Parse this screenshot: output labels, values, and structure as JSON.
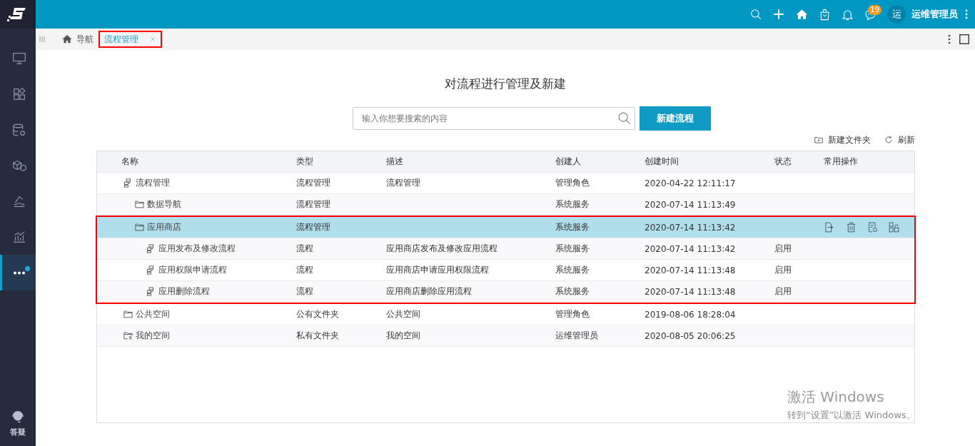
{
  "sidebar": {
    "items": [
      {
        "kind": "monitor",
        "selected": false,
        "notification": false
      },
      {
        "kind": "widgets",
        "selected": false,
        "notification": false
      },
      {
        "kind": "database",
        "selected": false,
        "notification": false
      },
      {
        "kind": "cubes",
        "selected": false,
        "notification": false
      },
      {
        "kind": "drafting",
        "selected": false,
        "notification": false
      },
      {
        "kind": "chart",
        "selected": false,
        "notification": false
      },
      {
        "kind": "more",
        "selected": true,
        "notification": true
      }
    ],
    "footer": {
      "label": "答疑"
    }
  },
  "topbar": {
    "actions": [
      {
        "kind": "search"
      },
      {
        "kind": "plus"
      },
      {
        "kind": "home"
      },
      {
        "kind": "bag"
      },
      {
        "kind": "bell"
      },
      {
        "kind": "message",
        "badge": "19"
      }
    ],
    "avatar": "运",
    "user": "运维管理员"
  },
  "tabs": [
    {
      "label": "导航",
      "kind": "home",
      "selected": false,
      "closable": false,
      "highlighted": false
    },
    {
      "label": "流程管理",
      "kind": "page",
      "selected": true,
      "closable": true,
      "highlighted": true
    }
  ],
  "page": {
    "title": "对流程进行管理及新建",
    "search": {
      "placeholder": "输入你想要搜索的内容"
    },
    "create_button": "新建流程",
    "tools": [
      {
        "kind": "new-folder",
        "label": "新建文件夹"
      },
      {
        "kind": "refresh",
        "label": "刷新"
      }
    ]
  },
  "table": {
    "columns": [
      "名称",
      "类型",
      "描述",
      "创建人",
      "创建时间",
      "状态",
      "常用操作"
    ],
    "rows": [
      {
        "kind": "flow",
        "name": "流程管理",
        "type": "流程管理",
        "description": "流程管理",
        "creator": "管理角色",
        "created": "2020-04-22 12:11:17",
        "selected": false,
        "highlighted": false,
        "children": [
          {
            "kind": "folder",
            "name": "数据导航",
            "type": "流程管理",
            "creator": "系统服务",
            "created": "2020-07-14 11:13:49",
            "selected": false,
            "highlighted": false
          },
          {
            "kind": "folder",
            "name": "应用商店",
            "type": "流程管理",
            "creator": "系统服务",
            "created": "2020-07-14 11:13:42",
            "selected": true,
            "highlighted": true,
            "children": [
              {
                "kind": "flow",
                "name": "应用发布及修改流程",
                "type": "流程",
                "description": "应用商店发布及修改应用流程",
                "creator": "系统服务",
                "created": "2020-07-14 11:13:42",
                "status": "启用",
                "selected": false,
                "highlighted": true
              },
              {
                "kind": "flow",
                "name": "应用权限申请流程",
                "type": "流程",
                "description": "应用商店申请应用权限流程",
                "creator": "系统服务",
                "created": "2020-07-14 11:13:48",
                "status": "启用",
                "selected": false,
                "highlighted": true
              },
              {
                "kind": "flow",
                "name": "应用删除流程",
                "type": "流程",
                "description": "应用商店删除应用流程",
                "creator": "系统服务",
                "created": "2020-07-14 11:13:48",
                "status": "启用",
                "selected": false,
                "highlighted": true
              }
            ]
          }
        ]
      },
      {
        "kind": "folder",
        "name": "公共空间",
        "type": "公有文件夹",
        "description": "公共空间",
        "creator": "管理角色",
        "created": "2019-08-06 18:28:04",
        "selected": false,
        "highlighted": false
      },
      {
        "kind": "private-folder",
        "name": "我的空间",
        "type": "私有文件夹",
        "description": "我的空间",
        "creator": "运维管理员",
        "created": "2020-08-05 20:06:25",
        "selected": false,
        "highlighted": false
      }
    ],
    "row_actions": [
      {
        "kind": "move"
      },
      {
        "kind": "delete"
      },
      {
        "kind": "settings"
      },
      {
        "kind": "permissions"
      }
    ]
  },
  "activation_notice": {
    "title": "激活 Windows",
    "text": "转到“设置”以激活 Windows。"
  }
}
